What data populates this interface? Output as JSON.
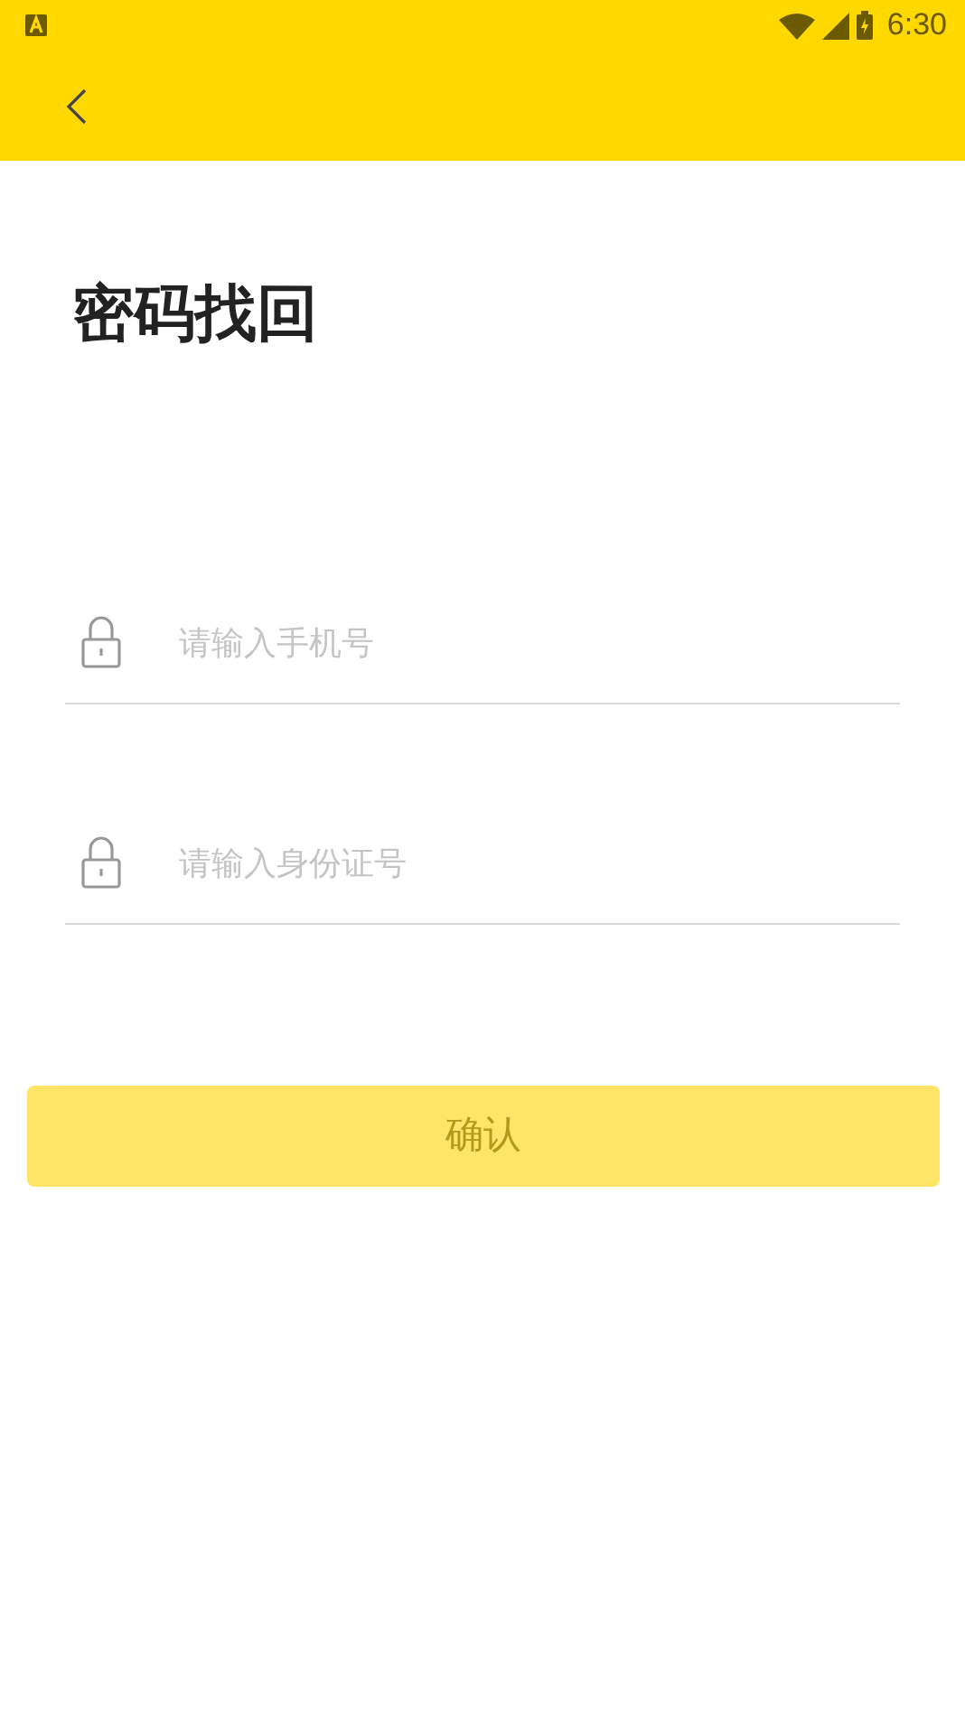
{
  "status_bar": {
    "time": "6:30"
  },
  "page": {
    "title": "密码找回"
  },
  "fields": [
    {
      "placeholder": "请输入手机号"
    },
    {
      "placeholder": "请输入身份证号"
    }
  ],
  "confirm_button": {
    "label": "确认",
    "disabled": true
  }
}
